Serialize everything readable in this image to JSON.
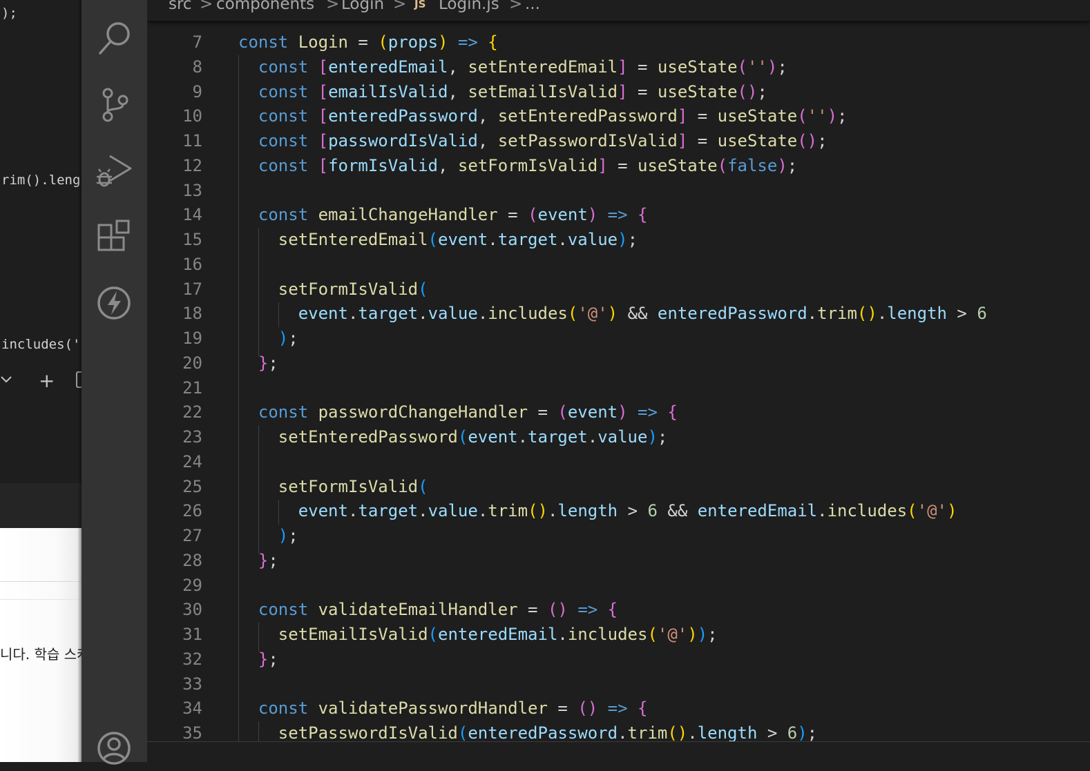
{
  "left_window": {
    "code_lines": [
      ");",
      "rim().leng",
      "includes('"
    ],
    "toolbar_plus": "+",
    "text_snippet": "니다. 학습 스케"
  },
  "breadcrumb": {
    "items": [
      "src",
      "components",
      "Login",
      "Login.js",
      "..."
    ],
    "separator": ">",
    "file_badge": "JS"
  },
  "activity_bar": {
    "icons": [
      "search-icon",
      "source-control-icon",
      "run-debug-icon",
      "extensions-icon",
      "thunder-icon",
      "account-icon"
    ]
  },
  "editor": {
    "line_numbers": [
      "7",
      "8",
      "9",
      "10",
      "11",
      "12",
      "13",
      "14",
      "15",
      "16",
      "17",
      "18",
      "19",
      "20",
      "21",
      "22",
      "23",
      "24",
      "25",
      "26",
      "27",
      "28",
      "29",
      "30",
      "31",
      "32",
      "33",
      "34",
      "35"
    ],
    "lines": [
      [
        [
          "kw",
          "const"
        ],
        [
          "pl",
          " "
        ],
        [
          "fn",
          "Login"
        ],
        [
          "pl",
          " = "
        ],
        [
          "b1",
          "("
        ],
        [
          "va",
          "props"
        ],
        [
          "b1",
          ")"
        ],
        [
          "pl",
          " "
        ],
        [
          "kw",
          "=>"
        ],
        [
          "pl",
          " "
        ],
        [
          "b1",
          "{"
        ]
      ],
      [
        [
          "pl",
          "  "
        ],
        [
          "kw",
          "const"
        ],
        [
          "pl",
          " "
        ],
        [
          "b2",
          "["
        ],
        [
          "va",
          "enteredEmail"
        ],
        [
          "pl",
          ", "
        ],
        [
          "fn",
          "setEnteredEmail"
        ],
        [
          "b2",
          "]"
        ],
        [
          "pl",
          " = "
        ],
        [
          "fn",
          "useState"
        ],
        [
          "b2",
          "("
        ],
        [
          "st",
          "''"
        ],
        [
          "b2",
          ")"
        ],
        [
          "pl",
          ";"
        ]
      ],
      [
        [
          "pl",
          "  "
        ],
        [
          "kw",
          "const"
        ],
        [
          "pl",
          " "
        ],
        [
          "b2",
          "["
        ],
        [
          "va",
          "emailIsValid"
        ],
        [
          "pl",
          ", "
        ],
        [
          "fn",
          "setEmailIsValid"
        ],
        [
          "b2",
          "]"
        ],
        [
          "pl",
          " = "
        ],
        [
          "fn",
          "useState"
        ],
        [
          "b2",
          "()"
        ],
        [
          "pl",
          ";"
        ]
      ],
      [
        [
          "pl",
          "  "
        ],
        [
          "kw",
          "const"
        ],
        [
          "pl",
          " "
        ],
        [
          "b2",
          "["
        ],
        [
          "va",
          "enteredPassword"
        ],
        [
          "pl",
          ", "
        ],
        [
          "fn",
          "setEnteredPassword"
        ],
        [
          "b2",
          "]"
        ],
        [
          "pl",
          " = "
        ],
        [
          "fn",
          "useState"
        ],
        [
          "b2",
          "("
        ],
        [
          "st",
          "''"
        ],
        [
          "b2",
          ")"
        ],
        [
          "pl",
          ";"
        ]
      ],
      [
        [
          "pl",
          "  "
        ],
        [
          "kw",
          "const"
        ],
        [
          "pl",
          " "
        ],
        [
          "b2",
          "["
        ],
        [
          "va",
          "passwordIsValid"
        ],
        [
          "pl",
          ", "
        ],
        [
          "fn",
          "setPasswordIsValid"
        ],
        [
          "b2",
          "]"
        ],
        [
          "pl",
          " = "
        ],
        [
          "fn",
          "useState"
        ],
        [
          "b2",
          "()"
        ],
        [
          "pl",
          ";"
        ]
      ],
      [
        [
          "pl",
          "  "
        ],
        [
          "kw",
          "const"
        ],
        [
          "pl",
          " "
        ],
        [
          "b2",
          "["
        ],
        [
          "va",
          "formIsValid"
        ],
        [
          "pl",
          ", "
        ],
        [
          "fn",
          "setFormIsValid"
        ],
        [
          "b2",
          "]"
        ],
        [
          "pl",
          " = "
        ],
        [
          "fn",
          "useState"
        ],
        [
          "b2",
          "("
        ],
        [
          "kw",
          "false"
        ],
        [
          "b2",
          ")"
        ],
        [
          "pl",
          ";"
        ]
      ],
      [],
      [
        [
          "pl",
          "  "
        ],
        [
          "kw",
          "const"
        ],
        [
          "pl",
          " "
        ],
        [
          "fn",
          "emailChangeHandler"
        ],
        [
          "pl",
          " = "
        ],
        [
          "b2",
          "("
        ],
        [
          "va",
          "event"
        ],
        [
          "b2",
          ")"
        ],
        [
          "pl",
          " "
        ],
        [
          "kw",
          "=>"
        ],
        [
          "pl",
          " "
        ],
        [
          "b2",
          "{"
        ]
      ],
      [
        [
          "pl",
          "    "
        ],
        [
          "fn",
          "setEnteredEmail"
        ],
        [
          "b3",
          "("
        ],
        [
          "va",
          "event"
        ],
        [
          "pl",
          "."
        ],
        [
          "va",
          "target"
        ],
        [
          "pl",
          "."
        ],
        [
          "va",
          "value"
        ],
        [
          "b3",
          ")"
        ],
        [
          "pl",
          ";"
        ]
      ],
      [],
      [
        [
          "pl",
          "    "
        ],
        [
          "fn",
          "setFormIsValid"
        ],
        [
          "b3",
          "("
        ]
      ],
      [
        [
          "pl",
          "      "
        ],
        [
          "va",
          "event"
        ],
        [
          "pl",
          "."
        ],
        [
          "va",
          "target"
        ],
        [
          "pl",
          "."
        ],
        [
          "va",
          "value"
        ],
        [
          "pl",
          "."
        ],
        [
          "fn",
          "includes"
        ],
        [
          "b1",
          "("
        ],
        [
          "st",
          "'@'"
        ],
        [
          "b1",
          ")"
        ],
        [
          "pl",
          " && "
        ],
        [
          "va",
          "enteredPassword"
        ],
        [
          "pl",
          "."
        ],
        [
          "fn",
          "trim"
        ],
        [
          "b1",
          "()"
        ],
        [
          "pl",
          "."
        ],
        [
          "va",
          "length"
        ],
        [
          "pl",
          " > "
        ],
        [
          "nu",
          "6"
        ]
      ],
      [
        [
          "pl",
          "    "
        ],
        [
          "b3",
          ")"
        ],
        [
          "pl",
          ";"
        ]
      ],
      [
        [
          "pl",
          "  "
        ],
        [
          "b2",
          "}"
        ],
        [
          "pl",
          ";"
        ]
      ],
      [],
      [
        [
          "pl",
          "  "
        ],
        [
          "kw",
          "const"
        ],
        [
          "pl",
          " "
        ],
        [
          "fn",
          "passwordChangeHandler"
        ],
        [
          "pl",
          " = "
        ],
        [
          "b2",
          "("
        ],
        [
          "va",
          "event"
        ],
        [
          "b2",
          ")"
        ],
        [
          "pl",
          " "
        ],
        [
          "kw",
          "=>"
        ],
        [
          "pl",
          " "
        ],
        [
          "b2",
          "{"
        ]
      ],
      [
        [
          "pl",
          "    "
        ],
        [
          "fn",
          "setEnteredPassword"
        ],
        [
          "b3",
          "("
        ],
        [
          "va",
          "event"
        ],
        [
          "pl",
          "."
        ],
        [
          "va",
          "target"
        ],
        [
          "pl",
          "."
        ],
        [
          "va",
          "value"
        ],
        [
          "b3",
          ")"
        ],
        [
          "pl",
          ";"
        ]
      ],
      [],
      [
        [
          "pl",
          "    "
        ],
        [
          "fn",
          "setFormIsValid"
        ],
        [
          "b3",
          "("
        ]
      ],
      [
        [
          "pl",
          "      "
        ],
        [
          "va",
          "event"
        ],
        [
          "pl",
          "."
        ],
        [
          "va",
          "target"
        ],
        [
          "pl",
          "."
        ],
        [
          "va",
          "value"
        ],
        [
          "pl",
          "."
        ],
        [
          "fn",
          "trim"
        ],
        [
          "b1",
          "()"
        ],
        [
          "pl",
          "."
        ],
        [
          "va",
          "length"
        ],
        [
          "pl",
          " > "
        ],
        [
          "nu",
          "6"
        ],
        [
          "pl",
          " && "
        ],
        [
          "va",
          "enteredEmail"
        ],
        [
          "pl",
          "."
        ],
        [
          "fn",
          "includes"
        ],
        [
          "b1",
          "("
        ],
        [
          "st",
          "'@'"
        ],
        [
          "b1",
          ")"
        ]
      ],
      [
        [
          "pl",
          "    "
        ],
        [
          "b3",
          ")"
        ],
        [
          "pl",
          ";"
        ]
      ],
      [
        [
          "pl",
          "  "
        ],
        [
          "b2",
          "}"
        ],
        [
          "pl",
          ";"
        ]
      ],
      [],
      [
        [
          "pl",
          "  "
        ],
        [
          "kw",
          "const"
        ],
        [
          "pl",
          " "
        ],
        [
          "fn",
          "validateEmailHandler"
        ],
        [
          "pl",
          " = "
        ],
        [
          "b2",
          "()"
        ],
        [
          "pl",
          " "
        ],
        [
          "kw",
          "=>"
        ],
        [
          "pl",
          " "
        ],
        [
          "b2",
          "{"
        ]
      ],
      [
        [
          "pl",
          "    "
        ],
        [
          "fn",
          "setEmailIsValid"
        ],
        [
          "b3",
          "("
        ],
        [
          "va",
          "enteredEmail"
        ],
        [
          "pl",
          "."
        ],
        [
          "fn",
          "includes"
        ],
        [
          "b1",
          "("
        ],
        [
          "st",
          "'@'"
        ],
        [
          "b1",
          ")"
        ],
        [
          "b3",
          ")"
        ],
        [
          "pl",
          ";"
        ]
      ],
      [
        [
          "pl",
          "  "
        ],
        [
          "b2",
          "}"
        ],
        [
          "pl",
          ";"
        ]
      ],
      [],
      [
        [
          "pl",
          "  "
        ],
        [
          "kw",
          "const"
        ],
        [
          "pl",
          " "
        ],
        [
          "fn",
          "validatePasswordHandler"
        ],
        [
          "pl",
          " = "
        ],
        [
          "b2",
          "()"
        ],
        [
          "pl",
          " "
        ],
        [
          "kw",
          "=>"
        ],
        [
          "pl",
          " "
        ],
        [
          "b2",
          "{"
        ]
      ],
      [
        [
          "pl",
          "    "
        ],
        [
          "fn",
          "setPasswordIsValid"
        ],
        [
          "b3",
          "("
        ],
        [
          "va",
          "enteredPassword"
        ],
        [
          "pl",
          "."
        ],
        [
          "fn",
          "trim"
        ],
        [
          "b1",
          "()"
        ],
        [
          "pl",
          "."
        ],
        [
          "va",
          "length"
        ],
        [
          "pl",
          " > "
        ],
        [
          "nu",
          "6"
        ],
        [
          "b3",
          ")"
        ],
        [
          "pl",
          ";"
        ]
      ]
    ]
  }
}
